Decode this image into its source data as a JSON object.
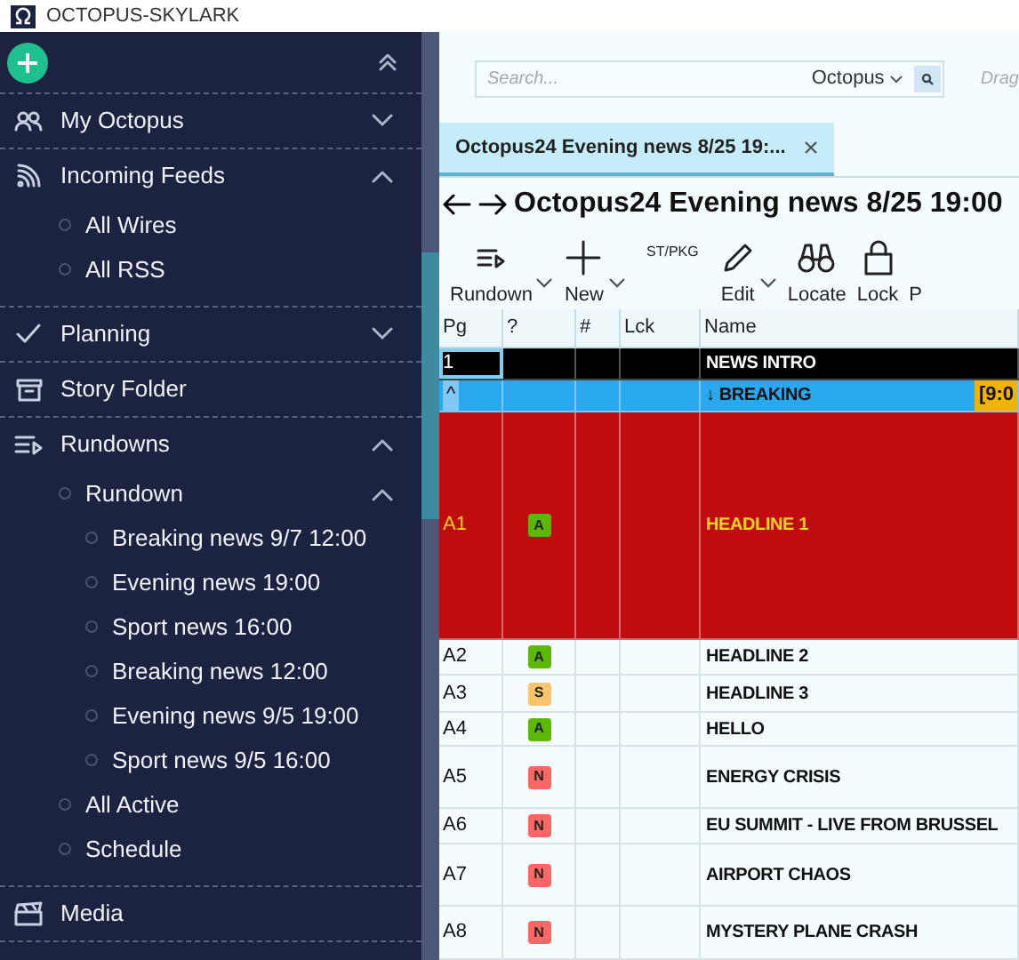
{
  "window": {
    "title": "OCTOPUS-SKYLARK"
  },
  "sidebar": {
    "items": [
      {
        "label": "My Octopus",
        "expanded": false
      },
      {
        "label": "Incoming Feeds",
        "expanded": true,
        "children": [
          {
            "label": "All Wires"
          },
          {
            "label": "All RSS"
          }
        ]
      },
      {
        "label": "Planning",
        "expanded": false
      },
      {
        "label": "Story Folder"
      },
      {
        "label": "Rundowns",
        "expanded": true,
        "children": [
          {
            "label": "Rundown",
            "expanded": true,
            "children": [
              {
                "label": "Breaking news 9/7 12:00"
              },
              {
                "label": "Evening news 19:00"
              },
              {
                "label": "Sport news 16:00"
              },
              {
                "label": "Breaking news 12:00"
              },
              {
                "label": "Evening news 9/5 19:00"
              },
              {
                "label": "Sport news 9/5 16:00"
              }
            ]
          },
          {
            "label": "All Active"
          },
          {
            "label": "Schedule"
          }
        ]
      },
      {
        "label": "Media"
      }
    ]
  },
  "search": {
    "placeholder": "Search...",
    "scope": "Octopus"
  },
  "drag_hint": "Drag",
  "tabs": [
    {
      "label": "Octopus24 Evening news 8/25 19:...",
      "selected": true
    }
  ],
  "rundown_title": "Octopus24 Evening news 8/25 19:00",
  "toolbar": [
    {
      "label": "Rundown",
      "kind": "button",
      "dropdown": true
    },
    {
      "label": "New",
      "kind": "button",
      "dropdown": true
    },
    {
      "label": "ST/PKG",
      "kind": "caption",
      "dropdown": false
    },
    {
      "label": "Edit",
      "kind": "button",
      "dropdown": true
    },
    {
      "label": "Locate",
      "kind": "button",
      "dropdown": false
    },
    {
      "label": "Lock",
      "kind": "button",
      "dropdown": false
    },
    {
      "label": "P",
      "kind": "button",
      "dropdown": false
    }
  ],
  "table": {
    "columns": [
      "Pg",
      "?",
      "#",
      "Lck",
      "Name"
    ],
    "rows": [
      {
        "kind": "intro",
        "pg": "1",
        "name": "NEWS INTRO",
        "selected": true
      },
      {
        "kind": "break",
        "pg": "^",
        "name": "↓ BREAKING",
        "tag": "[9:0",
        "selected": false
      },
      {
        "kind": "alert",
        "pg": "A1",
        "status": "A",
        "color": "#5cb800",
        "name": "HEADLINE 1",
        "selected": false
      },
      {
        "kind": "story",
        "pg": "A2",
        "status": "A",
        "color": "#5cb800",
        "name": "HEADLINE 2",
        "selected": false
      },
      {
        "kind": "story",
        "pg": "A3",
        "status": "S",
        "color": "#f9c46b",
        "name": "HEADLINE 3",
        "selected": false
      },
      {
        "kind": "story",
        "pg": "A4",
        "status": "A",
        "color": "#5cb800",
        "name": "HELLO",
        "selected": false
      },
      {
        "kind": "story",
        "pg": "A5",
        "status": "N",
        "color": "#ff6666",
        "name": "ENERGY CRISIS",
        "selected": false
      },
      {
        "kind": "story",
        "pg": "A6",
        "status": "N",
        "color": "#ff6666",
        "name": "EU SUMMIT - LIVE FROM BRUSSEL",
        "selected": false
      },
      {
        "kind": "story",
        "pg": "A7",
        "status": "N",
        "color": "#ff6666",
        "name": "AIRPORT CHAOS",
        "selected": false
      },
      {
        "kind": "story",
        "pg": "A8",
        "status": "N",
        "color": "#ff6666",
        "name": "MYSTERY PLANE CRASH",
        "selected": false
      }
    ]
  }
}
